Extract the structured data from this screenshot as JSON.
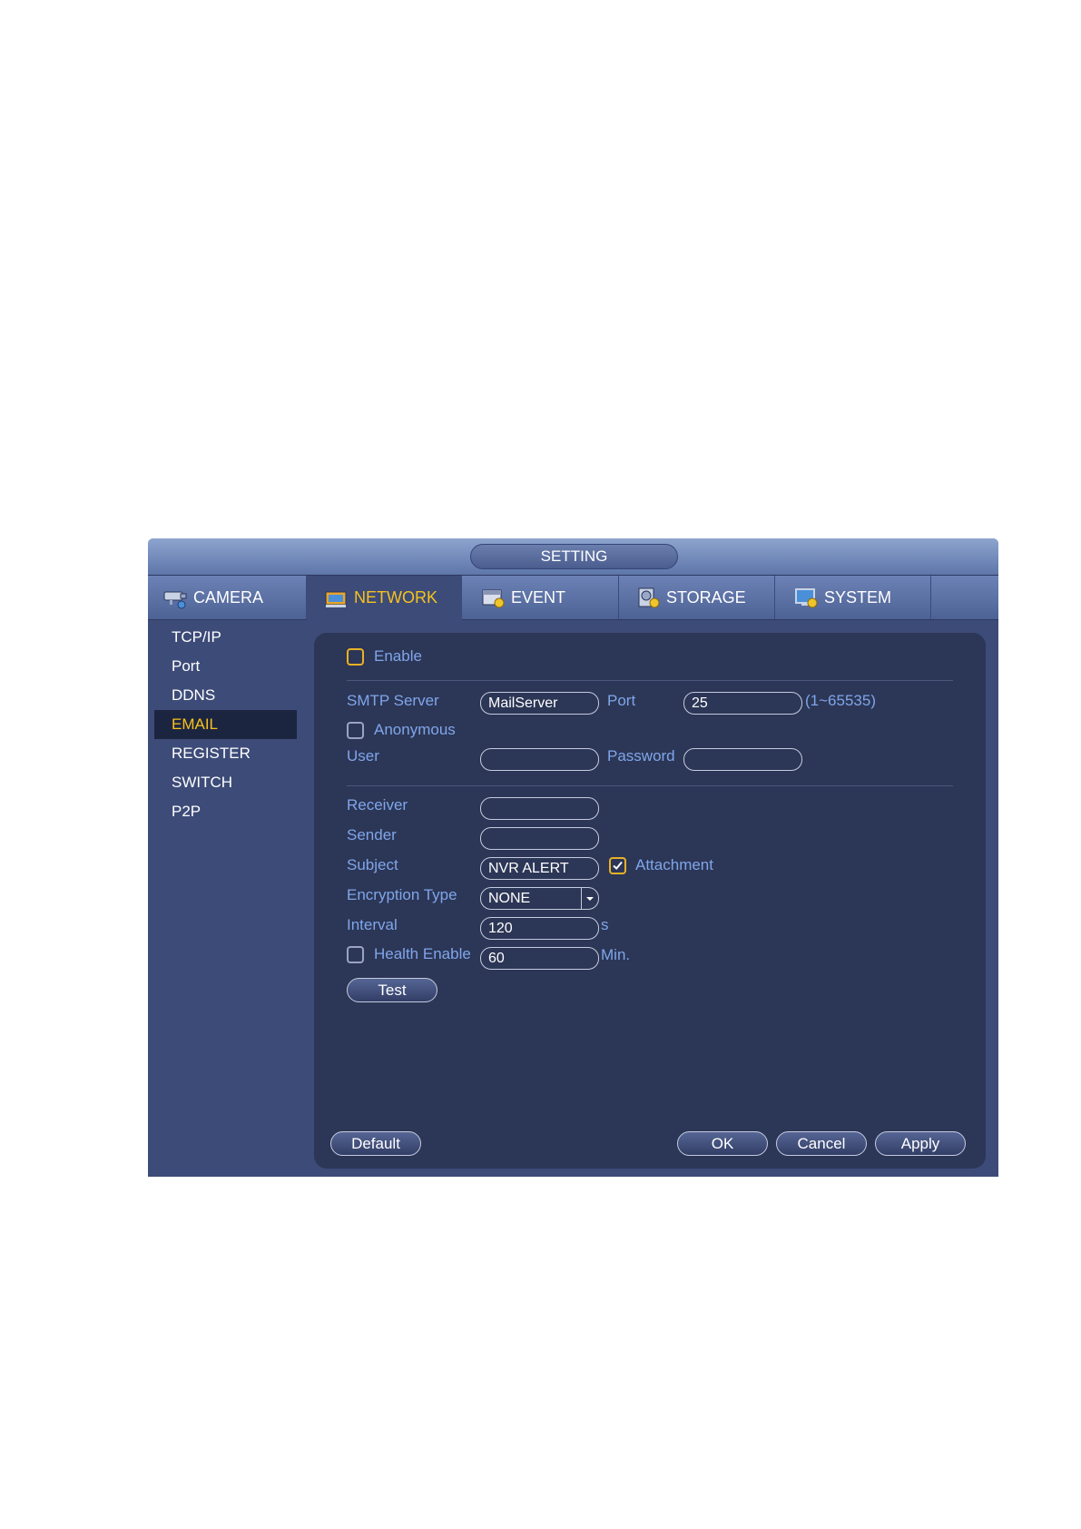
{
  "window": {
    "title": "SETTING"
  },
  "tabs": [
    {
      "label": "CAMERA",
      "icon": "camera-icon"
    },
    {
      "label": "NETWORK",
      "icon": "network-icon",
      "active": true
    },
    {
      "label": "EVENT",
      "icon": "event-icon"
    },
    {
      "label": "STORAGE",
      "icon": "storage-icon"
    },
    {
      "label": "SYSTEM",
      "icon": "system-icon"
    }
  ],
  "sidebar": {
    "items": [
      {
        "label": "TCP/IP"
      },
      {
        "label": "Port"
      },
      {
        "label": "DDNS"
      },
      {
        "label": "EMAIL",
        "active": true
      },
      {
        "label": "REGISTER"
      },
      {
        "label": "SWITCH"
      },
      {
        "label": "P2P"
      }
    ]
  },
  "form": {
    "enable": {
      "label": "Enable",
      "checked": false
    },
    "smtp_server": {
      "label": "SMTP Server",
      "value": "MailServer"
    },
    "port": {
      "label": "Port",
      "value": "25",
      "range": "(1~65535)"
    },
    "anonymous": {
      "label": "Anonymous",
      "checked": false
    },
    "user": {
      "label": "User",
      "value": ""
    },
    "password": {
      "label": "Password",
      "value": ""
    },
    "receiver": {
      "label": "Receiver",
      "value": ""
    },
    "sender": {
      "label": "Sender",
      "value": ""
    },
    "subject": {
      "label": "Subject",
      "value": "NVR ALERT"
    },
    "attachment": {
      "label": "Attachment",
      "checked": true
    },
    "encryption_type": {
      "label": "Encryption Type",
      "value": "NONE"
    },
    "interval": {
      "label": "Interval",
      "value": "120",
      "unit": "s"
    },
    "health_enable": {
      "label": "Health Enable",
      "checked": false,
      "value": "60",
      "unit": "Min."
    },
    "test_label": "Test"
  },
  "buttons": {
    "default": "Default",
    "ok": "OK",
    "cancel": "Cancel",
    "apply": "Apply"
  },
  "colors": {
    "accent": "#f6c21c",
    "label_blue": "#7fa6ea",
    "panel": "#2c3656",
    "window": "#3d4b78"
  }
}
